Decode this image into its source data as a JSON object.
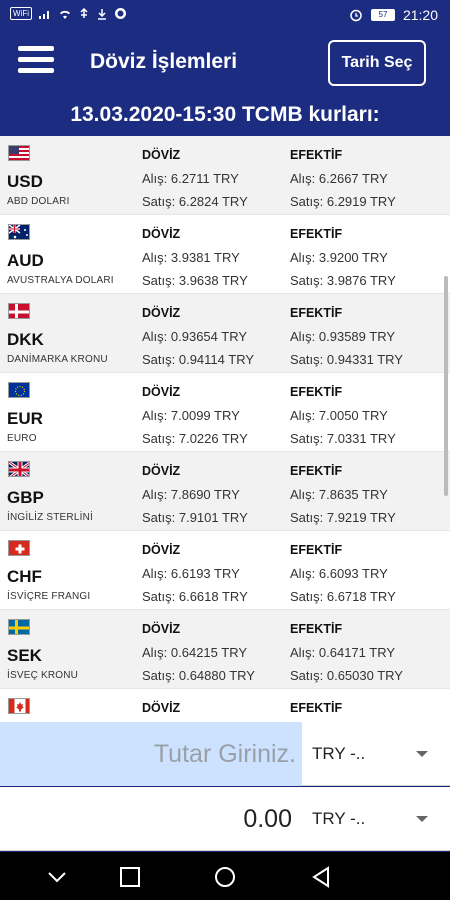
{
  "statusbar": {
    "left_chip": "WiFi",
    "battery": "57",
    "time": "21:20"
  },
  "appbar": {
    "title": "Döviz İşlemleri",
    "date_button": "Tarih Seç"
  },
  "subheader": "13.03.2020-15:30 TCMB kurları:",
  "column_headers": {
    "doviz": "DÖVİZ",
    "efektif": "EFEKTİF"
  },
  "currencies": [
    {
      "code": "USD",
      "name": "ABD DOLARI",
      "flag": "us",
      "doviz_alis": "Alış: 6.2711 TRY",
      "doviz_satis": "Satış: 6.2824 TRY",
      "efektif_alis": "Alış: 6.2667 TRY",
      "efektif_satis": "Satış: 6.2919 TRY"
    },
    {
      "code": "AUD",
      "name": "AVUSTRALYA DOLARI",
      "flag": "au",
      "doviz_alis": "Alış: 3.9381 TRY",
      "doviz_satis": "Satış: 3.9638 TRY",
      "efektif_alis": "Alış: 3.9200 TRY",
      "efektif_satis": "Satış: 3.9876 TRY"
    },
    {
      "code": "DKK",
      "name": "DANİMARKA KRONU",
      "flag": "dk",
      "doviz_alis": "Alış: 0.93654 TRY",
      "doviz_satis": "Satış: 0.94114 TRY",
      "efektif_alis": "Alış: 0.93589 TRY",
      "efektif_satis": "Satış: 0.94331 TRY"
    },
    {
      "code": "EUR",
      "name": "EURO",
      "flag": "eu",
      "doviz_alis": "Alış: 7.0099 TRY",
      "doviz_satis": "Satış: 7.0226 TRY",
      "efektif_alis": "Alış: 7.0050 TRY",
      "efektif_satis": "Satış: 7.0331 TRY"
    },
    {
      "code": "GBP",
      "name": "İNGİLİZ STERLİNİ",
      "flag": "gb",
      "doviz_alis": "Alış: 7.8690 TRY",
      "doviz_satis": "Satış: 7.9101 TRY",
      "efektif_alis": "Alış: 7.8635 TRY",
      "efektif_satis": "Satış: 7.9219 TRY"
    },
    {
      "code": "CHF",
      "name": "İSVİÇRE FRANGI",
      "flag": "ch",
      "doviz_alis": "Alış: 6.6193 TRY",
      "doviz_satis": "Satış: 6.6618 TRY",
      "efektif_alis": "Alış: 6.6093 TRY",
      "efektif_satis": "Satış: 6.6718 TRY"
    },
    {
      "code": "SEK",
      "name": "İSVEÇ KRONU",
      "flag": "se",
      "doviz_alis": "Alış: 0.64215 TRY",
      "doviz_satis": "Satış: 0.64880 TRY",
      "efektif_alis": "Alış: 0.64171 TRY",
      "efektif_satis": "Satış: 0.65030 TRY"
    },
    {
      "code": "",
      "name": "",
      "flag": "ca",
      "doviz_alis": "",
      "doviz_satis": "",
      "efektif_alis": "",
      "efektif_satis": ""
    }
  ],
  "converter": {
    "input_placeholder": "Tutar Giriniz.",
    "input_currency": "TRY -..",
    "output_value": "0.00",
    "output_currency": "TRY -.."
  },
  "colors": {
    "primary": "#1c2c80",
    "input_bg": "#cce2ff",
    "row_alt": "#f2f2f2"
  },
  "icons": {
    "status_left": [
      "sim-icon",
      "signal-icon",
      "wifi-icon",
      "usb-icon",
      "download-icon",
      "whatsapp-icon"
    ],
    "status_right": [
      "alarm-icon",
      "battery-icon"
    ],
    "nav": [
      "nav-down-icon",
      "recents-icon",
      "home-icon",
      "back-icon"
    ]
  }
}
